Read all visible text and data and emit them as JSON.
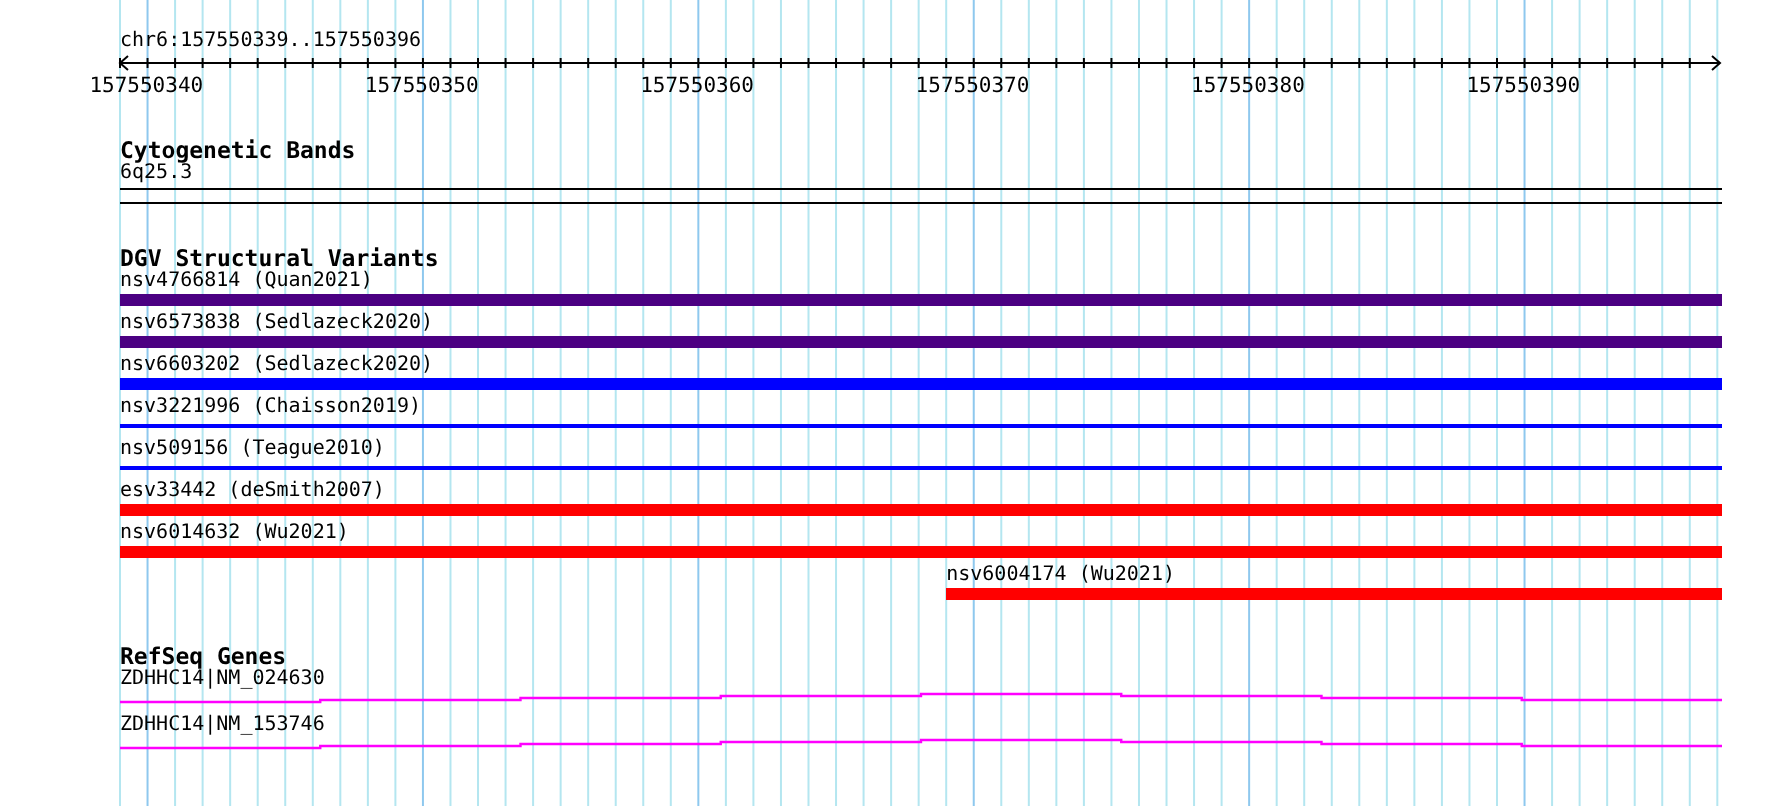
{
  "ruler": {
    "title": "chr6:157550339..157550396",
    "ticks": [
      "157550340",
      "157550350",
      "157550360",
      "157550370",
      "157550380",
      "157550390"
    ]
  },
  "tracks": [
    {
      "kind": "bands",
      "title": "Cytogenetic Bands",
      "features": [
        {
          "label": "6q25.3"
        }
      ]
    },
    {
      "kind": "variants",
      "title": "DGV Structural Variants",
      "features": [
        {
          "label": "nsv4766814 (Quan2021)",
          "color": "#4b0082",
          "kind": "thick"
        },
        {
          "label": "nsv6573838 (Sedlazeck2020)",
          "color": "#4b0082",
          "kind": "thick"
        },
        {
          "label": "nsv6603202 (Sedlazeck2020)",
          "color": "#0000ff",
          "kind": "thick"
        },
        {
          "label": "nsv3221996 (Chaisson2019)",
          "color": "#0000ff",
          "kind": "thin"
        },
        {
          "label": "nsv509156 (Teague2010)",
          "color": "#0000ff",
          "kind": "thin"
        },
        {
          "label": "esv33442 (deSmith2007)",
          "color": "#ff0000",
          "kind": "thick"
        },
        {
          "label": "nsv6014632 (Wu2021)",
          "color": "#ff0000",
          "kind": "thick"
        },
        {
          "label": "nsv6004174 (Wu2021)",
          "color": "#ff0000",
          "kind": "partial"
        }
      ]
    },
    {
      "kind": "genes",
      "title": "RefSeq Genes",
      "features": [
        {
          "label": "ZDHHC14|NM_024630"
        },
        {
          "label": "ZDHHC14|NM_153746"
        }
      ]
    }
  ]
}
